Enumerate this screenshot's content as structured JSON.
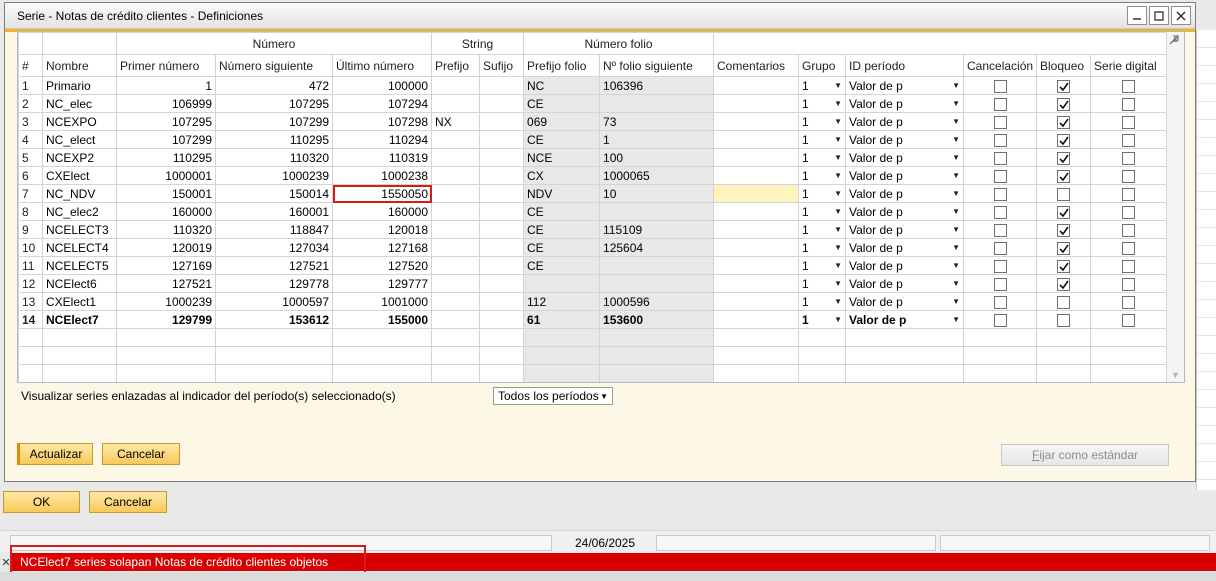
{
  "window": {
    "title": "Serie - Notas de crédito clientes - Definiciones",
    "minimize_icon": "minimize-icon",
    "maximize_icon": "maximize-icon",
    "close_icon": "close-icon"
  },
  "grid": {
    "groups": {
      "numero": "Número",
      "string": "String",
      "numero_folio": "Número folio"
    },
    "columns": [
      "#",
      "Nombre",
      "Primer número",
      "Número siguiente",
      "Último número",
      "Prefijo",
      "Sufijo",
      "Prefijo folio",
      "Nº folio siguiente",
      "Comentarios",
      "Grupo",
      "ID período",
      "Cancelación",
      "Bloqueo",
      "Serie digital"
    ],
    "rows": [
      {
        "n": "1",
        "nombre": "Primario",
        "primer": "1",
        "siguiente": "472",
        "ultimo": "100000",
        "prefijo": "",
        "sufijo": "",
        "prefijo_folio": "NC",
        "folio_sig": "106396",
        "comentarios": "",
        "grupo": "1",
        "periodo": "Valor de p",
        "cancel": false,
        "bloqueo": true,
        "digital": false
      },
      {
        "n": "2",
        "nombre": "NC_elec",
        "primer": "106999",
        "siguiente": "107295",
        "ultimo": "107294",
        "prefijo": "",
        "sufijo": "",
        "prefijo_folio": "CE",
        "folio_sig": "",
        "comentarios": "",
        "grupo": "1",
        "periodo": "Valor de p",
        "cancel": false,
        "bloqueo": true,
        "digital": false
      },
      {
        "n": "3",
        "nombre": "NCEXPO",
        "primer": "107295",
        "siguiente": "107299",
        "ultimo": "107298",
        "prefijo": "NX",
        "sufijo": "",
        "prefijo_folio": "069",
        "folio_sig": "73",
        "comentarios": "",
        "grupo": "1",
        "periodo": "Valor de p",
        "cancel": false,
        "bloqueo": true,
        "digital": false
      },
      {
        "n": "4",
        "nombre": "NC_elect",
        "primer": "107299",
        "siguiente": "110295",
        "ultimo": "110294",
        "prefijo": "",
        "sufijo": "",
        "prefijo_folio": "CE",
        "folio_sig": "1",
        "comentarios": "",
        "grupo": "1",
        "periodo": "Valor de p",
        "cancel": false,
        "bloqueo": true,
        "digital": false
      },
      {
        "n": "5",
        "nombre": "NCEXP2",
        "primer": "110295",
        "siguiente": "110320",
        "ultimo": "110319",
        "prefijo": "",
        "sufijo": "",
        "prefijo_folio": "NCE",
        "folio_sig": "100",
        "comentarios": "",
        "grupo": "1",
        "periodo": "Valor de p",
        "cancel": false,
        "bloqueo": true,
        "digital": false
      },
      {
        "n": "6",
        "nombre": "CXElect",
        "primer": "1000001",
        "siguiente": "1000239",
        "ultimo": "1000238",
        "prefijo": "",
        "sufijo": "",
        "prefijo_folio": "CX",
        "folio_sig": "1000065",
        "comentarios": "",
        "grupo": "1",
        "periodo": "Valor de p",
        "cancel": false,
        "bloqueo": true,
        "digital": false
      },
      {
        "n": "7",
        "nombre": "NC_NDV",
        "primer": "150001",
        "siguiente": "150014",
        "ultimo": "1550050",
        "prefijo": "",
        "sufijo": "",
        "prefijo_folio": "NDV",
        "folio_sig": "10",
        "comentarios": "",
        "grupo": "1",
        "periodo": "Valor de p",
        "cancel": false,
        "bloqueo": false,
        "digital": false
      },
      {
        "n": "8",
        "nombre": "NC_elec2",
        "primer": "160000",
        "siguiente": "160001",
        "ultimo": "160000",
        "prefijo": "",
        "sufijo": "",
        "prefijo_folio": "CE",
        "folio_sig": "",
        "comentarios": "",
        "grupo": "1",
        "periodo": "Valor de p",
        "cancel": false,
        "bloqueo": true,
        "digital": false
      },
      {
        "n": "9",
        "nombre": "NCELECT3",
        "primer": "110320",
        "siguiente": "118847",
        "ultimo": "120018",
        "prefijo": "",
        "sufijo": "",
        "prefijo_folio": "CE",
        "folio_sig": "115109",
        "comentarios": "",
        "grupo": "1",
        "periodo": "Valor de p",
        "cancel": false,
        "bloqueo": true,
        "digital": false
      },
      {
        "n": "10",
        "nombre": "NCELECT4",
        "primer": "120019",
        "siguiente": "127034",
        "ultimo": "127168",
        "prefijo": "",
        "sufijo": "",
        "prefijo_folio": "CE",
        "folio_sig": "125604",
        "comentarios": "",
        "grupo": "1",
        "periodo": "Valor de p",
        "cancel": false,
        "bloqueo": true,
        "digital": false
      },
      {
        "n": "11",
        "nombre": "NCELECT5",
        "primer": "127169",
        "siguiente": "127521",
        "ultimo": "127520",
        "prefijo": "",
        "sufijo": "",
        "prefijo_folio": "CE",
        "folio_sig": "",
        "comentarios": "",
        "grupo": "1",
        "periodo": "Valor de p",
        "cancel": false,
        "bloqueo": true,
        "digital": false
      },
      {
        "n": "12",
        "nombre": "NCElect6",
        "primer": "127521",
        "siguiente": "129778",
        "ultimo": "129777",
        "prefijo": "",
        "sufijo": "",
        "prefijo_folio": "",
        "folio_sig": "",
        "comentarios": "",
        "grupo": "1",
        "periodo": "Valor de p",
        "cancel": false,
        "bloqueo": true,
        "digital": false
      },
      {
        "n": "13",
        "nombre": "CXElect1",
        "primer": "1000239",
        "siguiente": "1000597",
        "ultimo": "1001000",
        "prefijo": "",
        "sufijo": "",
        "prefijo_folio": "112",
        "folio_sig": "1000596",
        "comentarios": "",
        "grupo": "1",
        "periodo": "Valor de p",
        "cancel": false,
        "bloqueo": false,
        "digital": false
      },
      {
        "n": "14",
        "nombre": "NCElect7",
        "primer": "129799",
        "siguiente": "153612",
        "ultimo": "155000",
        "prefijo": "",
        "sufijo": "",
        "prefijo_folio": "61",
        "folio_sig": "153600",
        "comentarios": "",
        "grupo": "1",
        "periodo": "Valor de p",
        "cancel": false,
        "bloqueo": false,
        "digital": false
      }
    ]
  },
  "filter": {
    "label": "Visualizar series enlazadas al indicador del período(s) seleccionado(s)",
    "value": "Todos los períodos"
  },
  "buttons": {
    "update": "Actualizar",
    "cancel_inner": "Cancelar",
    "set_default": "Fijar como estándar",
    "ok": "OK",
    "cancel_outer": "Cancelar"
  },
  "status": {
    "date": "24/06/2025",
    "error": "NCElect7 series solapan Notas de crédito clientes objetos"
  },
  "colors": {
    "accent": "#f0b429",
    "error": "#d80000",
    "highlight_outline": "#d61b1b"
  }
}
